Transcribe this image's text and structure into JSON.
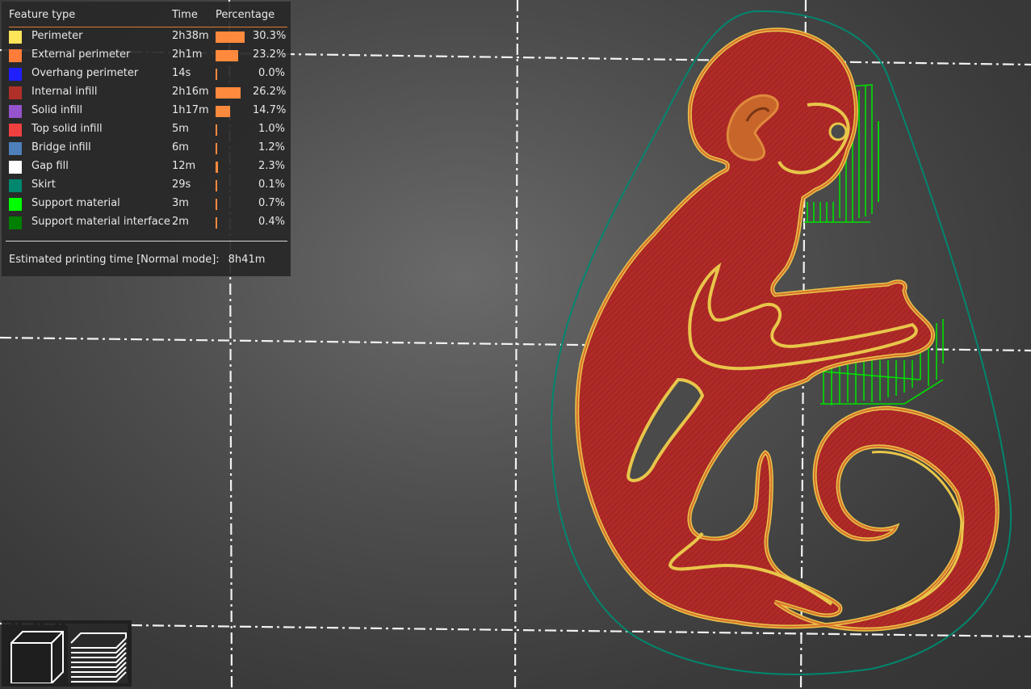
{
  "legend": {
    "headers": {
      "type": "Feature type",
      "time": "Time",
      "percentage": "Percentage"
    },
    "rows": [
      {
        "name": "Perimeter",
        "time": "2h38m",
        "pct": "30.3%",
        "share": 0.303,
        "color": "#ffe55a"
      },
      {
        "name": "External perimeter",
        "time": "2h1m",
        "pct": "23.2%",
        "share": 0.232,
        "color": "#ff7d38"
      },
      {
        "name": "Overhang perimeter",
        "time": "14s",
        "pct": "0.0%",
        "share": 0.0,
        "color": "#1f1fff"
      },
      {
        "name": "Internal infill",
        "time": "2h16m",
        "pct": "26.2%",
        "share": 0.262,
        "color": "#b03029"
      },
      {
        "name": "Solid infill",
        "time": "1h17m",
        "pct": "14.7%",
        "share": 0.147,
        "color": "#9654cc"
      },
      {
        "name": "Top solid infill",
        "time": "5m",
        "pct": "1.0%",
        "share": 0.01,
        "color": "#f04040"
      },
      {
        "name": "Bridge infill",
        "time": "6m",
        "pct": "1.2%",
        "share": 0.012,
        "color": "#4d80ba"
      },
      {
        "name": "Gap fill",
        "time": "12m",
        "pct": "2.3%",
        "share": 0.023,
        "color": "#ffffff"
      },
      {
        "name": "Skirt",
        "time": "29s",
        "pct": "0.1%",
        "share": 0.001,
        "color": "#00876e"
      },
      {
        "name": "Support material",
        "time": "3m",
        "pct": "0.7%",
        "share": 0.007,
        "color": "#00ff00"
      },
      {
        "name": "Support material interface",
        "time": "2m",
        "pct": "0.4%",
        "share": 0.004,
        "color": "#008000"
      }
    ],
    "estimate_label": "Estimated printing time [Normal mode]:",
    "estimate_value": "8h41m"
  },
  "view_toggle": {
    "buttons": [
      {
        "icon": "cube-icon",
        "label": "3D view"
      },
      {
        "icon": "layers-icon",
        "label": "Layers view"
      }
    ]
  },
  "colors": {
    "model_infill": "#b02a28",
    "perimeter": "#e8c64a",
    "external_perimeter": "#e0782c",
    "skirt": "#00876e",
    "support": "#00e000",
    "bed_grid": "#ffffff"
  }
}
